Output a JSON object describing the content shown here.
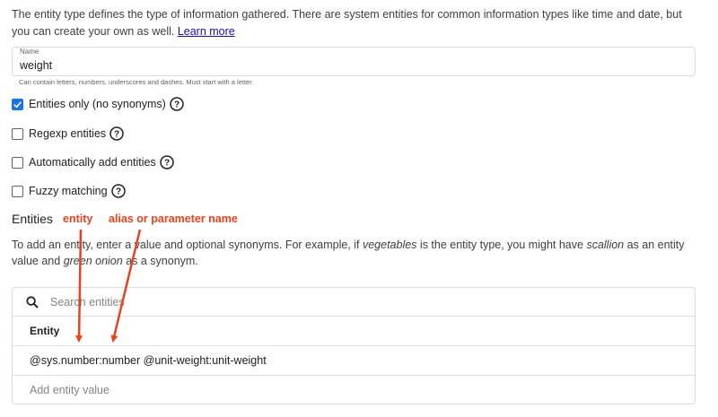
{
  "intro": {
    "text": "The entity type defines the type of information gathered. There are system entities for common information types like time and date, but you can create your own as well.",
    "learn_more": "Learn more"
  },
  "name_field": {
    "label": "Name",
    "value": "weight",
    "hint": "Can contain letters, numbers, underscores and dashes. Must start with a letter."
  },
  "options": [
    {
      "label": "Entities only (no synonyms)",
      "checked": true
    },
    {
      "label": "Regexp entities",
      "checked": false
    },
    {
      "label": "Automatically add entities",
      "checked": false
    },
    {
      "label": "Fuzzy matching",
      "checked": false
    }
  ],
  "entities_section": {
    "heading": "Entities",
    "desc_part1": "To add an entity, enter a value and optional synonyms. For example, if ",
    "desc_em1": "vegetables",
    "desc_part2": " is the entity type, you might have ",
    "desc_em2": "scallion",
    "desc_part3": " as an entity value and ",
    "desc_em3": "green onion",
    "desc_part4": " as a synonym."
  },
  "annotations": {
    "entity": "entity",
    "alias": "alias or parameter name",
    "color": "#e8421f"
  },
  "table": {
    "search_placeholder": "Search entities",
    "column_header": "Entity",
    "rows": [
      "@sys.number:number @unit-weight:unit-weight"
    ],
    "add_placeholder": "Add entity value"
  },
  "colors": {
    "checkbox_checked": "#1a73e8",
    "link": "#1a0dab"
  }
}
